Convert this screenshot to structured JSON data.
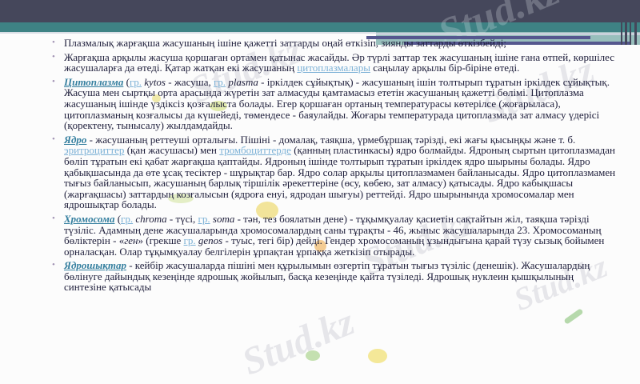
{
  "palette": {
    "header_dark": "#45475B",
    "header_teal": "#3E8284",
    "header_light_teal": "#98BFBC",
    "header_purple": "#55578E",
    "body_text": "#1D1D3A",
    "term_link": "#357F9F",
    "inline_link": "#7CB1D6"
  },
  "watermark": {
    "text": "Stud.kz"
  },
  "slide": {
    "bullet_char": "•",
    "bullets": [
      {
        "runs": [
          {
            "t": "Плазмалық жарғақша жасушаның ішіне қажетті заттарды оңай өткізіп, зиянды заттарды өткізбейді;"
          }
        ]
      },
      {
        "runs": [
          {
            "t": "Жарғақша арқылы жасуша қоршаған ортамен қатынас жасайды. Әр түрлі заттар тек жасушаның ішіне ғана өтпей, көршілес жасушаларға да өтеді. Қатар жатқан екі жасушаның "
          },
          {
            "t": "цитоплазмалары",
            "c": "link"
          },
          {
            "t": " саңылау арқылы бір-біріне өтеді."
          }
        ]
      },
      {
        "runs": [
          {
            "t": "Цитоплазма",
            "c": "term"
          },
          {
            "t": " ("
          },
          {
            "t": "гр.",
            "c": "link"
          },
          {
            "t": " "
          },
          {
            "t": "kytos",
            "c": "it"
          },
          {
            "t": " - жасуша, "
          },
          {
            "t": "гр.",
            "c": "link"
          },
          {
            "t": " "
          },
          {
            "t": "plasma",
            "c": "it"
          },
          {
            "t": " - іркілдек сұйықтық) - жасушаның ішін толтырып тұратын іркілдек сұйықтық. Жасуша мен сыртқы орта арасында жүретін зат алмасуды қамтамасыз ететін жасушаның қажетті бөлімі. Цитоплазма жасушаның ішінде үздіксіз қозғалыста болады. Егер қоршаған ортаның температурасы көтерілсе (жоғарыласа), цитоплазманың козғалысы да күшейеді, төмендесе - баяулайды. Жоғары температурада цитоплазмада зат алмасу үдерісі (қоректену, тынысалу) жылдамдайды."
          }
        ]
      },
      {
        "runs": [
          {
            "t": "Ядро",
            "c": "term"
          },
          {
            "t": " - жасушаның реттеуші орталығы. Пішіні - домалақ, таяқша, үрмебұршақ тәрізді, екі жағы қысыңқы және т. б. "
          },
          {
            "t": "эритроциттер",
            "c": "link"
          },
          {
            "t": " (қан жасушасы) мен "
          },
          {
            "t": "тромбоциттерде",
            "c": "link"
          },
          {
            "t": " (қанның пластинкасы) ядро болмайды. Ядроның сыртын цитоплазмадан бөліп тұратын екі қабат жарғақша қаптайды. Ядроның ішінде толтырып тұратын іркілдек ядро шырыны болады. Ядро қабықшасында да өте ұсақ тесіктер - шұрықтар бар. Ядро солар арқылы цитоплазмамен байланысады. Ядро цитоплазмамен тығыз байланысып, жасушаның барлық тіршілік әрекеттеріне (өсу, көбею, зат алмасу) қатысады. Ядро кабықшасы (жарғақшасы) заттардың козғалысын (ядроға енуі, ядродан шығуы) реттейді. Ядро шырынында хромосомалар мен ядрошықтар болады."
          }
        ]
      },
      {
        "runs": [
          {
            "t": "Хромосома",
            "c": "term"
          },
          {
            "t": " ("
          },
          {
            "t": "гр.",
            "c": "link"
          },
          {
            "t": " "
          },
          {
            "t": "chroma",
            "c": "it"
          },
          {
            "t": " - түсі, "
          },
          {
            "t": "гр.",
            "c": "link"
          },
          {
            "t": " "
          },
          {
            "t": "soma",
            "c": "it"
          },
          {
            "t": " - тән, тез боялатын дене) - тұқымқуалау қасиетін сақтайтын жіл, таяқша тәрізді түзіліс. Адамның дене жасушаларында хромосомалардың саны тұрақты - 46, жыныс жасушаларында 23. Хромосоманың бөліктерін - «"
          },
          {
            "t": "ген",
            "c": "it"
          },
          {
            "t": "» (грекше "
          },
          {
            "t": "гр.",
            "c": "link"
          },
          {
            "t": " "
          },
          {
            "t": "genos",
            "c": "it"
          },
          {
            "t": " - туыс, тегі бір) дейді. Гендер хромосоманың ұзындығына қарай түзу сызық бойымен орналасқан. Олар тұқымқуалау белгілерін ұрпақтан ұрпаққа жеткізіп отырады."
          }
        ]
      },
      {
        "runs": [
          {
            "t": "Ядрошықтар",
            "c": "term"
          },
          {
            "t": " - кейбір жасушаларда пішіні мен құрылымын өзгертіп тұратын тығыз түзіліс (денешік). Жасушалардың бөлінуге дайындық кезеңінде ядрошық жойылып, басқа кезеңінде қайта түзіледі. Ядрошық нуклеин қышқылының синтезіне қатысады"
          }
        ]
      }
    ]
  }
}
